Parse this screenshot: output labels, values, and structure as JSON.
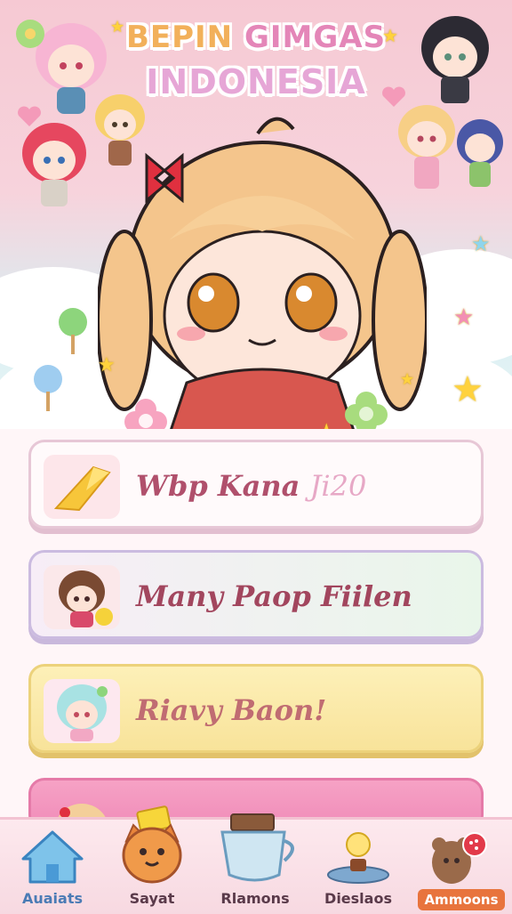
{
  "hero": {
    "title_line1_a": "BEPIN",
    "title_line1_b": "GIMGAS",
    "title_line2": "INDONESIA"
  },
  "cards": [
    {
      "label": "Wbp Kana",
      "suffix": "Ji20",
      "icon": "crystal-gem-icon"
    },
    {
      "label": "Many Paop Fiilen",
      "icon": "brown-hair-chibi-avatar"
    },
    {
      "label": "Riavy Baon!",
      "icon": "mint-hair-chibi-avatar"
    },
    {
      "label": "",
      "icon": "blonde-chibi-avatar"
    }
  ],
  "tabs": [
    {
      "label": "Auaiats",
      "icon": "home-icon",
      "active": true
    },
    {
      "label": "Sayat",
      "icon": "cat-face-icon"
    },
    {
      "label": "Rlamons",
      "icon": "teacup-icon"
    },
    {
      "label": "Dieslaos",
      "icon": "lamp-icon"
    },
    {
      "label": "Ammoons",
      "icon": "bear-icon",
      "badge": true
    }
  ],
  "colors": {
    "accent_pink": "#e486b8",
    "accent_orange": "#f2b05a",
    "tab_pill": "#e8743d"
  }
}
